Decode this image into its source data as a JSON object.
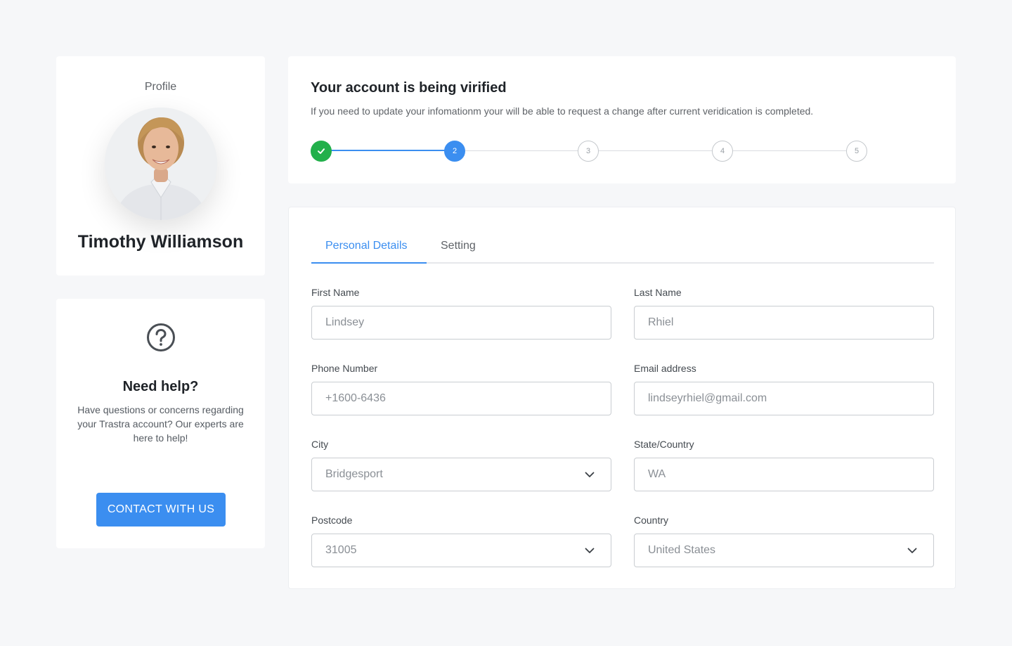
{
  "profile": {
    "label": "Profile",
    "name": "Timothy Williamson"
  },
  "help": {
    "icon": "question-circle-icon",
    "title": "Need help?",
    "text": "Have questions or concerns regarding your Trastra account? Our experts are here to help!",
    "button_label": "CONTACT WITH US"
  },
  "verification": {
    "title": "Your account is being virified",
    "subtitle": "If you need to update your infomationm your will be able to request a change after current veridication is completed.",
    "steps": [
      {
        "label": "",
        "state": "done"
      },
      {
        "label": "2",
        "state": "current"
      },
      {
        "label": "3",
        "state": "pending"
      },
      {
        "label": "4",
        "state": "pending"
      },
      {
        "label": "5",
        "state": "pending"
      }
    ]
  },
  "tabs": {
    "personal": "Personal Details",
    "setting": "Setting",
    "active": "personal"
  },
  "form": {
    "first_name": {
      "label": "First Name",
      "value": "Lindsey"
    },
    "last_name": {
      "label": "Last Name",
      "value": "Rhiel"
    },
    "phone": {
      "label": "Phone Number",
      "value": "+1600-6436"
    },
    "email": {
      "label": "Email address",
      "value": "lindseyrhiel@gmail.com"
    },
    "city": {
      "label": "City",
      "value": "Bridgesport"
    },
    "state": {
      "label": "State/Country",
      "value": "WA"
    },
    "postcode": {
      "label": "Postcode",
      "value": "31005"
    },
    "country": {
      "label": "Country",
      "value": "United States"
    }
  },
  "colors": {
    "accent": "#3b8ef0",
    "success": "#22b04b",
    "background": "#f6f7f9"
  }
}
